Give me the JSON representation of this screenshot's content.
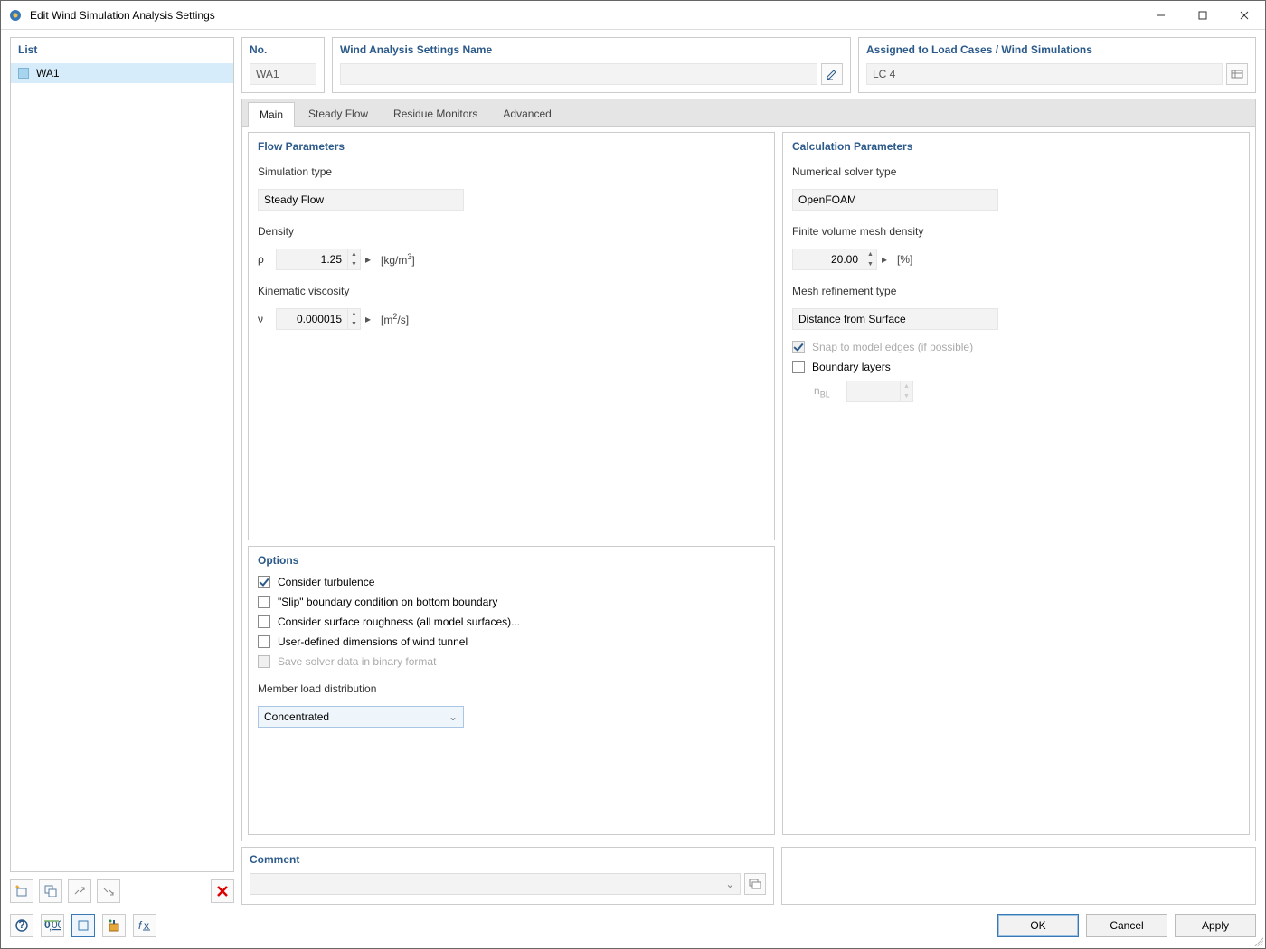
{
  "window": {
    "title": "Edit Wind Simulation Analysis Settings"
  },
  "list": {
    "title": "List",
    "items": [
      {
        "label": "WA1"
      }
    ]
  },
  "header": {
    "no_label": "No.",
    "no_value": "WA1",
    "name_label": "Wind Analysis Settings Name",
    "name_value": "",
    "assigned_label": "Assigned to Load Cases / Wind Simulations",
    "assigned_value": "LC 4"
  },
  "tabs": [
    "Main",
    "Steady Flow",
    "Residue Monitors",
    "Advanced"
  ],
  "active_tab": "Main",
  "flow": {
    "title": "Flow Parameters",
    "sim_type_label": "Simulation type",
    "sim_type_value": "Steady Flow",
    "density_label": "Density",
    "density_sym": "ρ",
    "density_value": "1.25",
    "density_unit": "[kg/m³]",
    "kin_label": "Kinematic viscosity",
    "kin_sym": "ν",
    "kin_value": "0.000015",
    "kin_unit": "[m²/s]"
  },
  "options": {
    "title": "Options",
    "turbulence": "Consider turbulence",
    "slip": "\"Slip\" boundary condition on bottom boundary",
    "roughness": "Consider surface roughness (all model surfaces)...",
    "user_tunnel": "User-defined dimensions of wind tunnel",
    "save_binary": "Save solver data in binary format",
    "mld_label": "Member load distribution",
    "mld_value": "Concentrated"
  },
  "calc": {
    "title": "Calculation Parameters",
    "solver_label": "Numerical solver type",
    "solver_value": "OpenFOAM",
    "mesh_density_label": "Finite volume mesh density",
    "mesh_density_value": "20.00",
    "mesh_density_unit": "[%]",
    "refine_label": "Mesh refinement type",
    "refine_value": "Distance from Surface",
    "snap": "Snap to model edges (if possible)",
    "boundary": "Boundary layers",
    "nbl_sym": "nBL",
    "nbl_value": ""
  },
  "comment": {
    "title": "Comment",
    "value": ""
  },
  "buttons": {
    "ok": "OK",
    "cancel": "Cancel",
    "apply": "Apply"
  }
}
